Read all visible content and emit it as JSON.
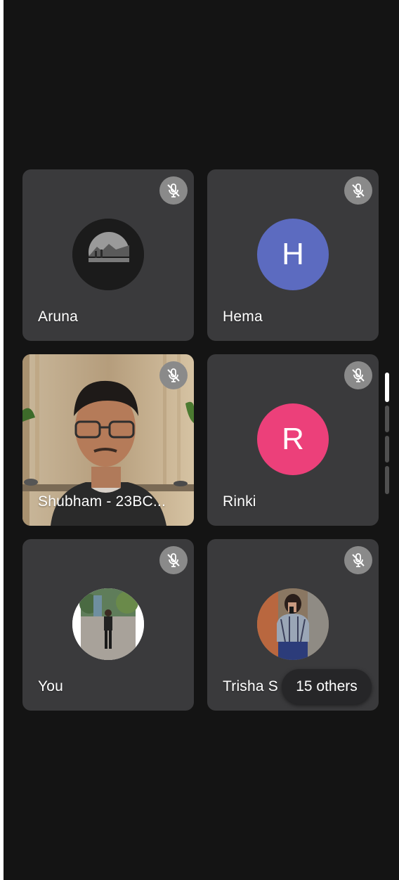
{
  "participants": [
    {
      "name": "Aruna",
      "avatar_type": "photo-landscape",
      "muted": true
    },
    {
      "name": "Hema",
      "avatar_type": "letter",
      "avatar_letter": "H",
      "avatar_color": "#5c6bc0",
      "muted": true
    },
    {
      "name": "Shubham - 23BC...",
      "avatar_type": "video",
      "muted": true
    },
    {
      "name": "Rinki",
      "avatar_type": "letter",
      "avatar_letter": "R",
      "avatar_color": "#ec407a",
      "muted": true
    },
    {
      "name": "You",
      "avatar_type": "photo-person",
      "muted": true
    },
    {
      "name": "Trisha S",
      "avatar_type": "photo-person",
      "muted": true
    }
  ],
  "others_label": "15 others",
  "icons": {
    "mute": "mic-off-icon"
  },
  "colors": {
    "background": "#141414",
    "tile": "#3a3a3c",
    "mute_badge": "#8a8a8a"
  }
}
